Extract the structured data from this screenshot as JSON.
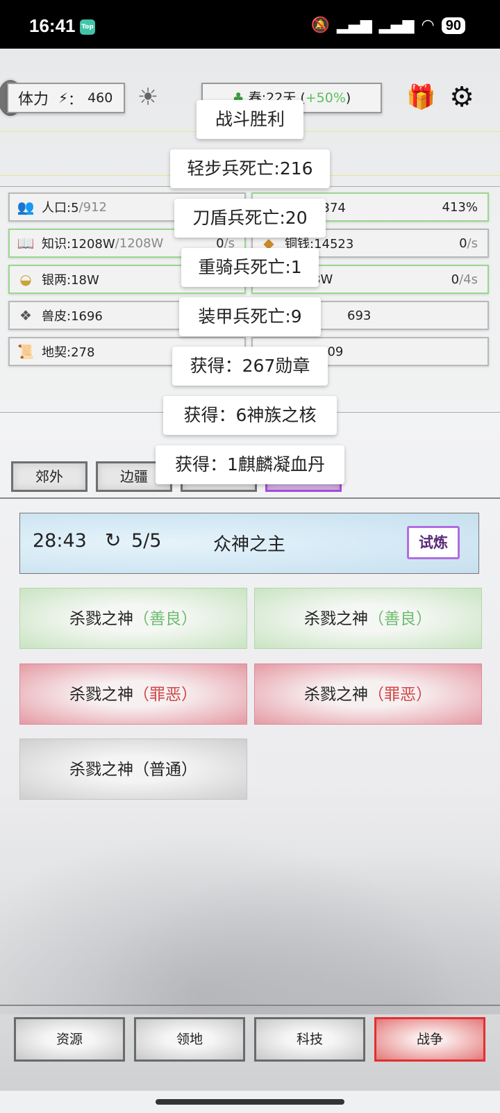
{
  "status_bar": {
    "time": "16:41",
    "app_badge": "Top",
    "icons": [
      "bell-off-icon",
      "signal-icon",
      "signal-icon",
      "wifi-icon"
    ],
    "battery": "90"
  },
  "top_bar": {
    "stamina_label": "体力",
    "stamina_sep": "：",
    "stamina_value": "460",
    "season_text": "春:22天 (",
    "season_bonus": "+50%",
    "season_close": ")"
  },
  "resources": [
    {
      "icon": "people-icon",
      "label": "人口:5",
      "max": "/912",
      "rate": "",
      "unit": "",
      "green": false
    },
    {
      "icon": "food-icon",
      "label": "粮食:8374",
      "max": "",
      "rate": "413%",
      "unit": "",
      "green": true
    },
    {
      "icon": "book-icon",
      "label": "知识:1208W",
      "max": "/1208W",
      "rate": "0",
      "unit": "/s",
      "green": true
    },
    {
      "icon": "coin-icon",
      "label": "铜钱:14523",
      "max": "",
      "rate": "0",
      "unit": "/s",
      "green": false
    },
    {
      "icon": "silver-icon",
      "label": "银两:18W",
      "max": "",
      "rate": "",
      "unit": "",
      "green": true
    },
    {
      "icon": "gold-icon",
      "label": "8W",
      "max": "",
      "rate": "0",
      "unit": "/4s",
      "green": true
    },
    {
      "icon": "hide-icon",
      "label": "兽皮:1696",
      "max": "",
      "rate": "",
      "unit": "",
      "green": false
    },
    {
      "icon": "item-icon",
      "label": "693",
      "max": "",
      "rate": "",
      "unit": "",
      "green": false
    },
    {
      "icon": "deed-icon",
      "label": "地契:278",
      "max": "",
      "rate": "",
      "unit": "",
      "green": false
    },
    {
      "icon": "item2-icon",
      "label": "309",
      "max": "",
      "rate": "",
      "unit": "",
      "green": false
    }
  ],
  "tabs": [
    "郊外",
    "边疆",
    "",
    ""
  ],
  "popups": [
    "战斗胜利",
    "轻步兵死亡:216",
    "刀盾兵死亡:20",
    "重骑兵死亡:1",
    "装甲兵死亡:9",
    "获得：267勋章",
    "获得：6神族之核",
    "获得：1麒麟凝血丹"
  ],
  "boss": {
    "timer": "28:43",
    "count": "5/5",
    "name": "众神之主",
    "trial_label": "试炼"
  },
  "monsters": [
    {
      "name": "杀戮之神",
      "tag": "（善良）",
      "type": "good"
    },
    {
      "name": "杀戮之神",
      "tag": "（善良）",
      "type": "good"
    },
    {
      "name": "杀戮之神",
      "tag": "（罪恶）",
      "type": "evil"
    },
    {
      "name": "杀戮之神",
      "tag": "（罪恶）",
      "type": "evil"
    },
    {
      "name": "杀戮之神",
      "tag": "（普通）",
      "type": "normal"
    }
  ],
  "bottom_nav": [
    "资源",
    "领地",
    "科技",
    "战争"
  ],
  "colors": {
    "accent_red": "#e03030",
    "accent_purple": "#a64bd6",
    "good_green": "#6cbd6c",
    "evil_red": "#d04848"
  }
}
